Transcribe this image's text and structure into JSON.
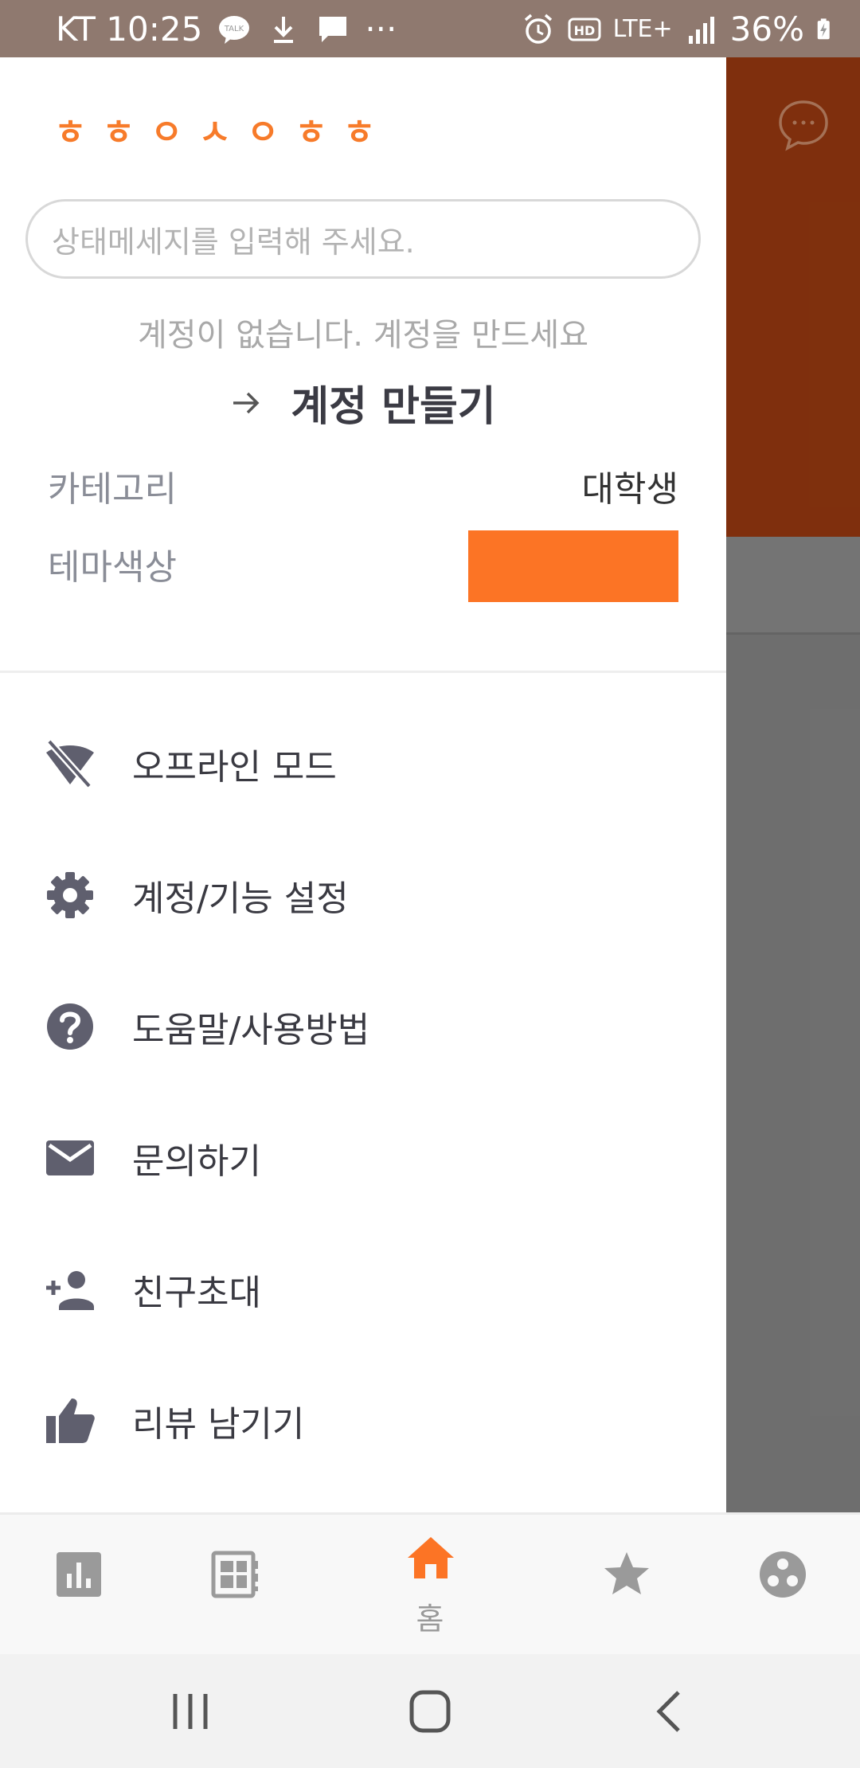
{
  "status_bar": {
    "carrier_time": "KT 10:25",
    "talk_badge": "TALK",
    "more": "···",
    "network": "LTE+",
    "battery": "36%"
  },
  "drawer": {
    "logo": "ㅎㅎㅇㅅㅇㅎㅎ",
    "status_placeholder": "상태메세지를 입력해 주세요.",
    "no_account_text": "계정이 없습니다. 계정을 만드세요",
    "create_account_label": "계정 만들기",
    "category_label": "카테고리",
    "category_value": "대학생",
    "theme_label": "테마색상",
    "theme_color": "#fc7425",
    "menu": [
      {
        "label": "오프라인 모드",
        "icon": "wifi-off-icon"
      },
      {
        "label": "계정/기능 설정",
        "icon": "gear-icon"
      },
      {
        "label": "도움말/사용방법",
        "icon": "help-icon"
      },
      {
        "label": "문의하기",
        "icon": "mail-icon"
      },
      {
        "label": "친구초대",
        "icon": "add-person-icon"
      },
      {
        "label": "리뷰 남기기",
        "icon": "thumbs-up-icon"
      }
    ]
  },
  "tab_bar": {
    "tabs": [
      {
        "icon": "bar-chart-icon"
      },
      {
        "icon": "newspaper-icon"
      },
      {
        "icon": "home-icon",
        "label": "홈",
        "active": true
      },
      {
        "icon": "star-icon"
      },
      {
        "icon": "community-icon"
      }
    ],
    "active_color": "#fc7425",
    "inactive_color": "#9a9a9a"
  },
  "nav_bar": {
    "buttons": [
      "recent-apps-icon",
      "home-button-icon",
      "back-icon"
    ]
  }
}
